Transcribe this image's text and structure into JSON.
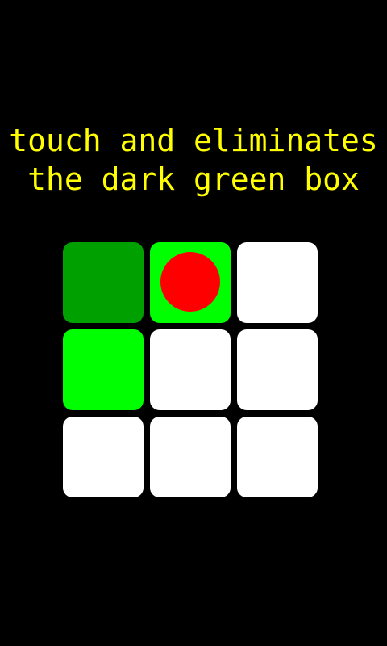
{
  "instruction": {
    "line1": "touch and eliminates",
    "line2": "the dark green box"
  },
  "colors": {
    "background": "#000000",
    "text": "#ffff00",
    "dark_green": "#00a000",
    "bright_green": "#00ff00",
    "empty": "#ffffff",
    "marker": "#ff0000"
  },
  "board": {
    "rows": 3,
    "cols": 3,
    "tiles": [
      {
        "state": "dark-green",
        "marker": false
      },
      {
        "state": "bright-green",
        "marker": true
      },
      {
        "state": "empty",
        "marker": false
      },
      {
        "state": "bright-green",
        "marker": false
      },
      {
        "state": "empty",
        "marker": false
      },
      {
        "state": "empty",
        "marker": false
      },
      {
        "state": "empty",
        "marker": false
      },
      {
        "state": "empty",
        "marker": false
      },
      {
        "state": "empty",
        "marker": false
      }
    ]
  }
}
